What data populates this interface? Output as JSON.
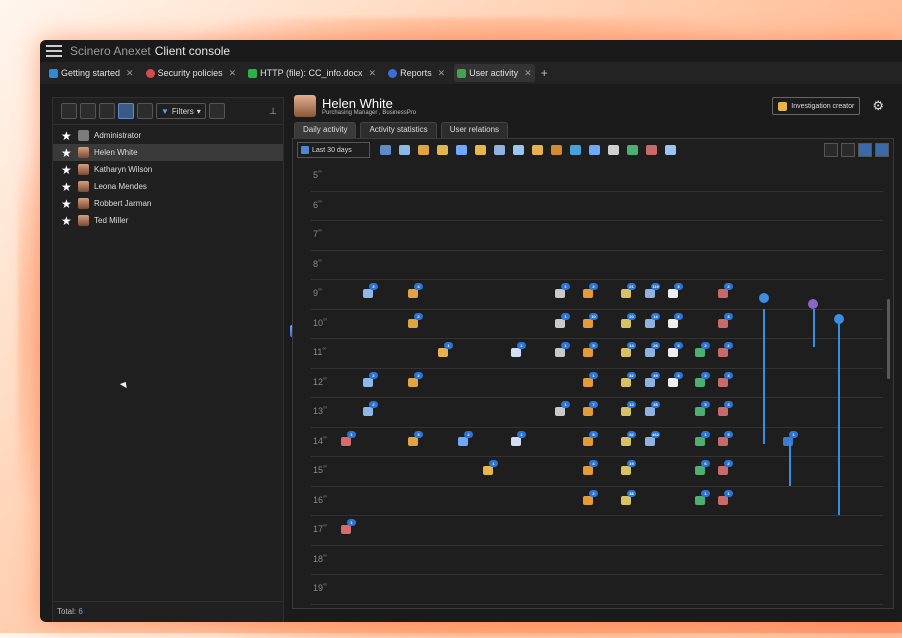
{
  "window": {
    "title_prefix": "Scinero Anexet",
    "title_main": "Client console",
    "server": "localhost"
  },
  "tabs": [
    {
      "label": "Getting started",
      "color": "#2e8ad6"
    },
    {
      "label": "Security policies",
      "color": "#d64b4b"
    },
    {
      "label": "HTTP (file): CC_info.docx",
      "color": "#29b34a"
    },
    {
      "label": "Reports",
      "color": "#3a6ed8"
    },
    {
      "label": "User activity",
      "color": "#3fa64a"
    }
  ],
  "left": {
    "filters_label": "Filters",
    "users": [
      "Administrator",
      "Helen White",
      "Katharyn Wilson",
      "Leona Mendes",
      "Robbert Jarman",
      "Ted Miller"
    ],
    "total_label": "Total:",
    "total_value": "6"
  },
  "header": {
    "name": "Helen White",
    "role": "Purchasing Manager , BusinessPro",
    "investigation": "Investigation creator"
  },
  "subtabs": [
    "Daily activity",
    "Activity statistics",
    "User relations"
  ],
  "range": "Last 30 days",
  "hours": [
    "5",
    "6",
    "7",
    "8",
    "9",
    "10",
    "11",
    "12",
    "13",
    "14",
    "15",
    "16",
    "17",
    "18",
    "19"
  ],
  "accent": "#2b75d6"
}
